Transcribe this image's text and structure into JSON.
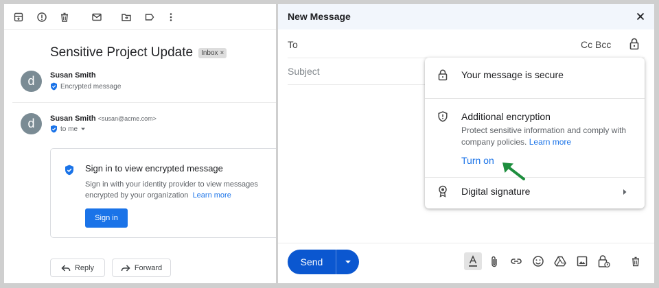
{
  "left": {
    "toolbar_icons": [
      "archive-icon",
      "report-spam-icon",
      "delete-icon",
      "mark-unread-icon",
      "move-to-icon",
      "label-icon",
      "more-vert-icon"
    ],
    "subject": "Sensitive Project Update",
    "inbox_chip": "Inbox",
    "inbox_chip_close": "×",
    "message1": {
      "avatar": "d",
      "sender": "Susan Smith",
      "status": "Encrypted message"
    },
    "message2": {
      "avatar": "d",
      "sender": "Susan Smith",
      "email": "<susan@acme.com>",
      "to": "to me"
    },
    "card": {
      "title": "Sign in to view encrypted message",
      "body": "Sign in with your identity provider to view messages encrypted by your organization",
      "learn_more": "Learn more",
      "sign_in": "Sign in"
    },
    "reply": "Reply",
    "forward": "Forward"
  },
  "compose": {
    "title": "New Message",
    "to_label": "To",
    "cc_bcc": "Cc Bcc",
    "subject_placeholder": "Subject",
    "send": "Send"
  },
  "security_panel": {
    "secure_text": "Your message is secure",
    "encryption_title": "Additional encryption",
    "encryption_desc": "Protect sensitive information and comply with company policies.",
    "learn_more": "Learn more",
    "turn_on": "Turn on",
    "digital_signature": "Digital signature"
  },
  "colors": {
    "accent": "#1a73e8",
    "send_button": "#0b57d0",
    "annotation_arrow": "#1e8e3e",
    "avatar": "#7a8b94"
  }
}
